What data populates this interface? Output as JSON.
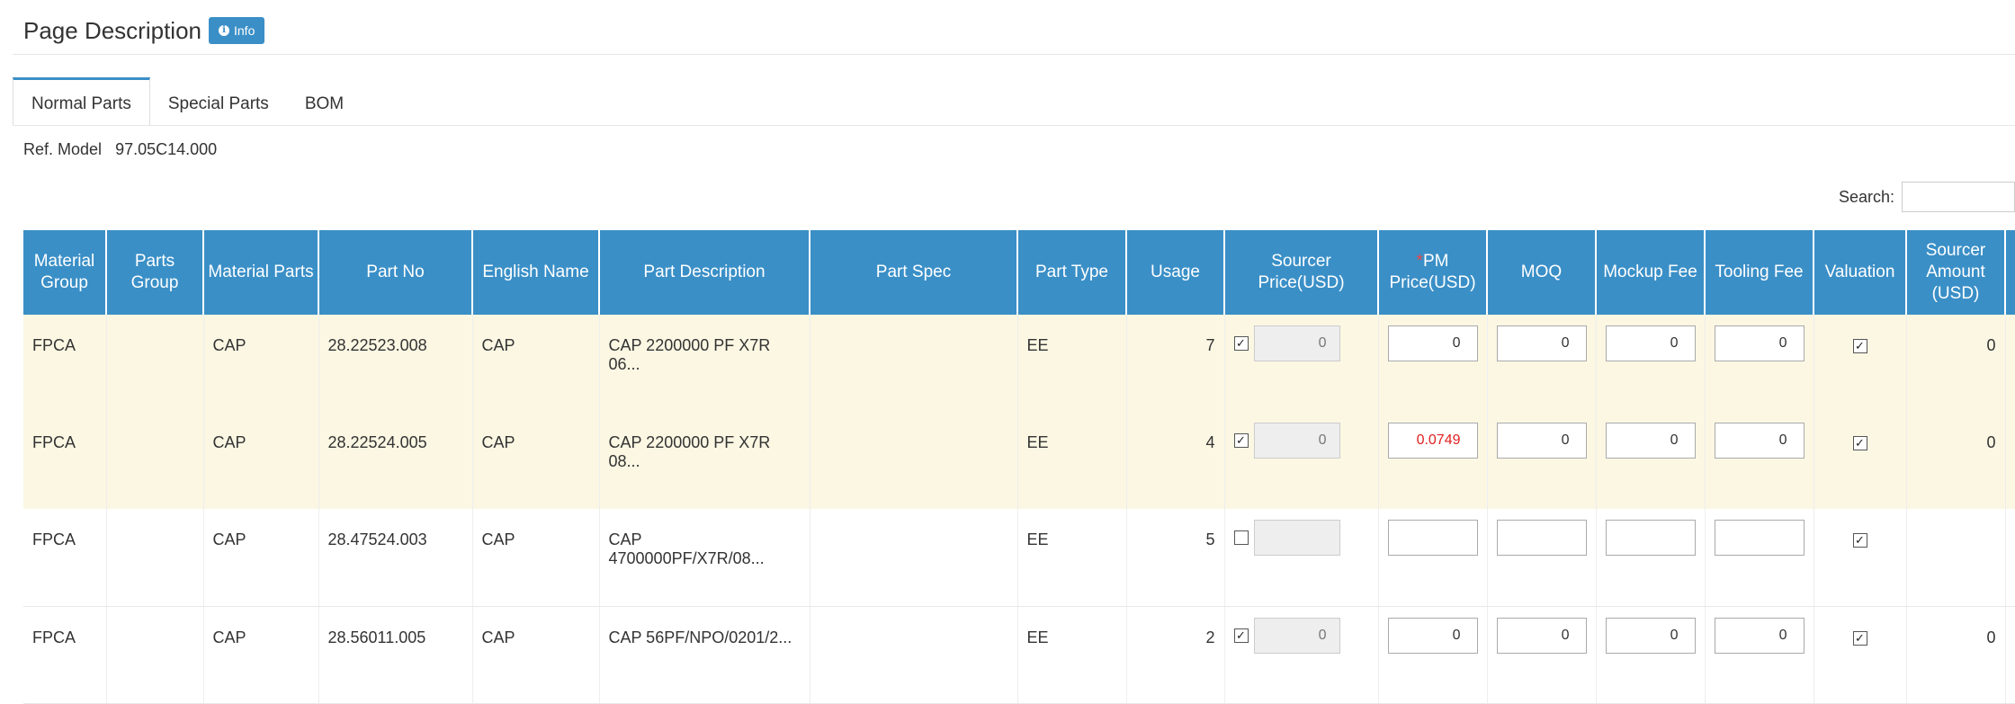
{
  "header": {
    "title": "Page Description",
    "info_label": "Info",
    "info_icon": "info-circle-icon"
  },
  "tabs": [
    {
      "label": "Normal Parts",
      "active": true
    },
    {
      "label": "Special Parts",
      "active": false
    },
    {
      "label": "BOM",
      "active": false
    }
  ],
  "ref": {
    "label": "Ref. Model",
    "value": "97.05C14.000"
  },
  "search": {
    "label": "Search:",
    "value": ""
  },
  "columns": [
    "Material Group",
    "Parts Group",
    "Material Parts",
    "Part No",
    "English Name",
    "Part Description",
    "Part Spec",
    "Part Type",
    "Usage",
    "Sourcer Price(USD)",
    "PM Price(USD)",
    "MOQ",
    "Mockup Fee",
    "Tooling Fee",
    "Valuation",
    "Sourcer Amount (USD)"
  ],
  "pm_required_mark": "*",
  "rows": [
    {
      "material_group": "FPCA",
      "parts_group": "",
      "material_parts": "CAP",
      "part_no": "28.22523.008",
      "english_name": "CAP",
      "part_description": "CAP 2200000 PF X7R 06...",
      "part_spec": "",
      "part_type": "EE",
      "usage": "7",
      "sourcer_checked": true,
      "sourcer_price": "0",
      "pm_price": "0",
      "moq": "0",
      "mockup_fee": "0",
      "tooling_fee": "0",
      "valuation": true,
      "sourcer_amount": "0"
    },
    {
      "material_group": "FPCA",
      "parts_group": "",
      "material_parts": "CAP",
      "part_no": "28.22524.005",
      "english_name": "CAP",
      "part_description": "CAP 2200000 PF X7R 08...",
      "part_spec": "",
      "part_type": "EE",
      "usage": "4",
      "sourcer_checked": true,
      "sourcer_price": "0",
      "pm_price": "0.0749",
      "moq": "0",
      "mockup_fee": "0",
      "tooling_fee": "0",
      "valuation": true,
      "sourcer_amount": "0"
    },
    {
      "material_group": "FPCA",
      "parts_group": "",
      "material_parts": "CAP",
      "part_no": "28.47524.003",
      "english_name": "CAP",
      "part_description": "CAP 4700000PF/X7R/08...",
      "part_spec": "",
      "part_type": "EE",
      "usage": "5",
      "sourcer_checked": false,
      "sourcer_price": "",
      "pm_price": "",
      "moq": "",
      "mockup_fee": "",
      "tooling_fee": "",
      "valuation": true,
      "sourcer_amount": ""
    },
    {
      "material_group": "FPCA",
      "parts_group": "",
      "material_parts": "CAP",
      "part_no": "28.56011.005",
      "english_name": "CAP",
      "part_description": "CAP 56PF/NPO/0201/2...",
      "part_spec": "",
      "part_type": "EE",
      "usage": "2",
      "sourcer_checked": true,
      "sourcer_price": "0",
      "pm_price": "0",
      "moq": "0",
      "mockup_fee": "0",
      "tooling_fee": "0",
      "valuation": true,
      "sourcer_amount": "0"
    }
  ],
  "colors": {
    "accent": "#3a8fc7",
    "highlight_row": "#fbf7e3",
    "pm_alert": "#e02020"
  }
}
